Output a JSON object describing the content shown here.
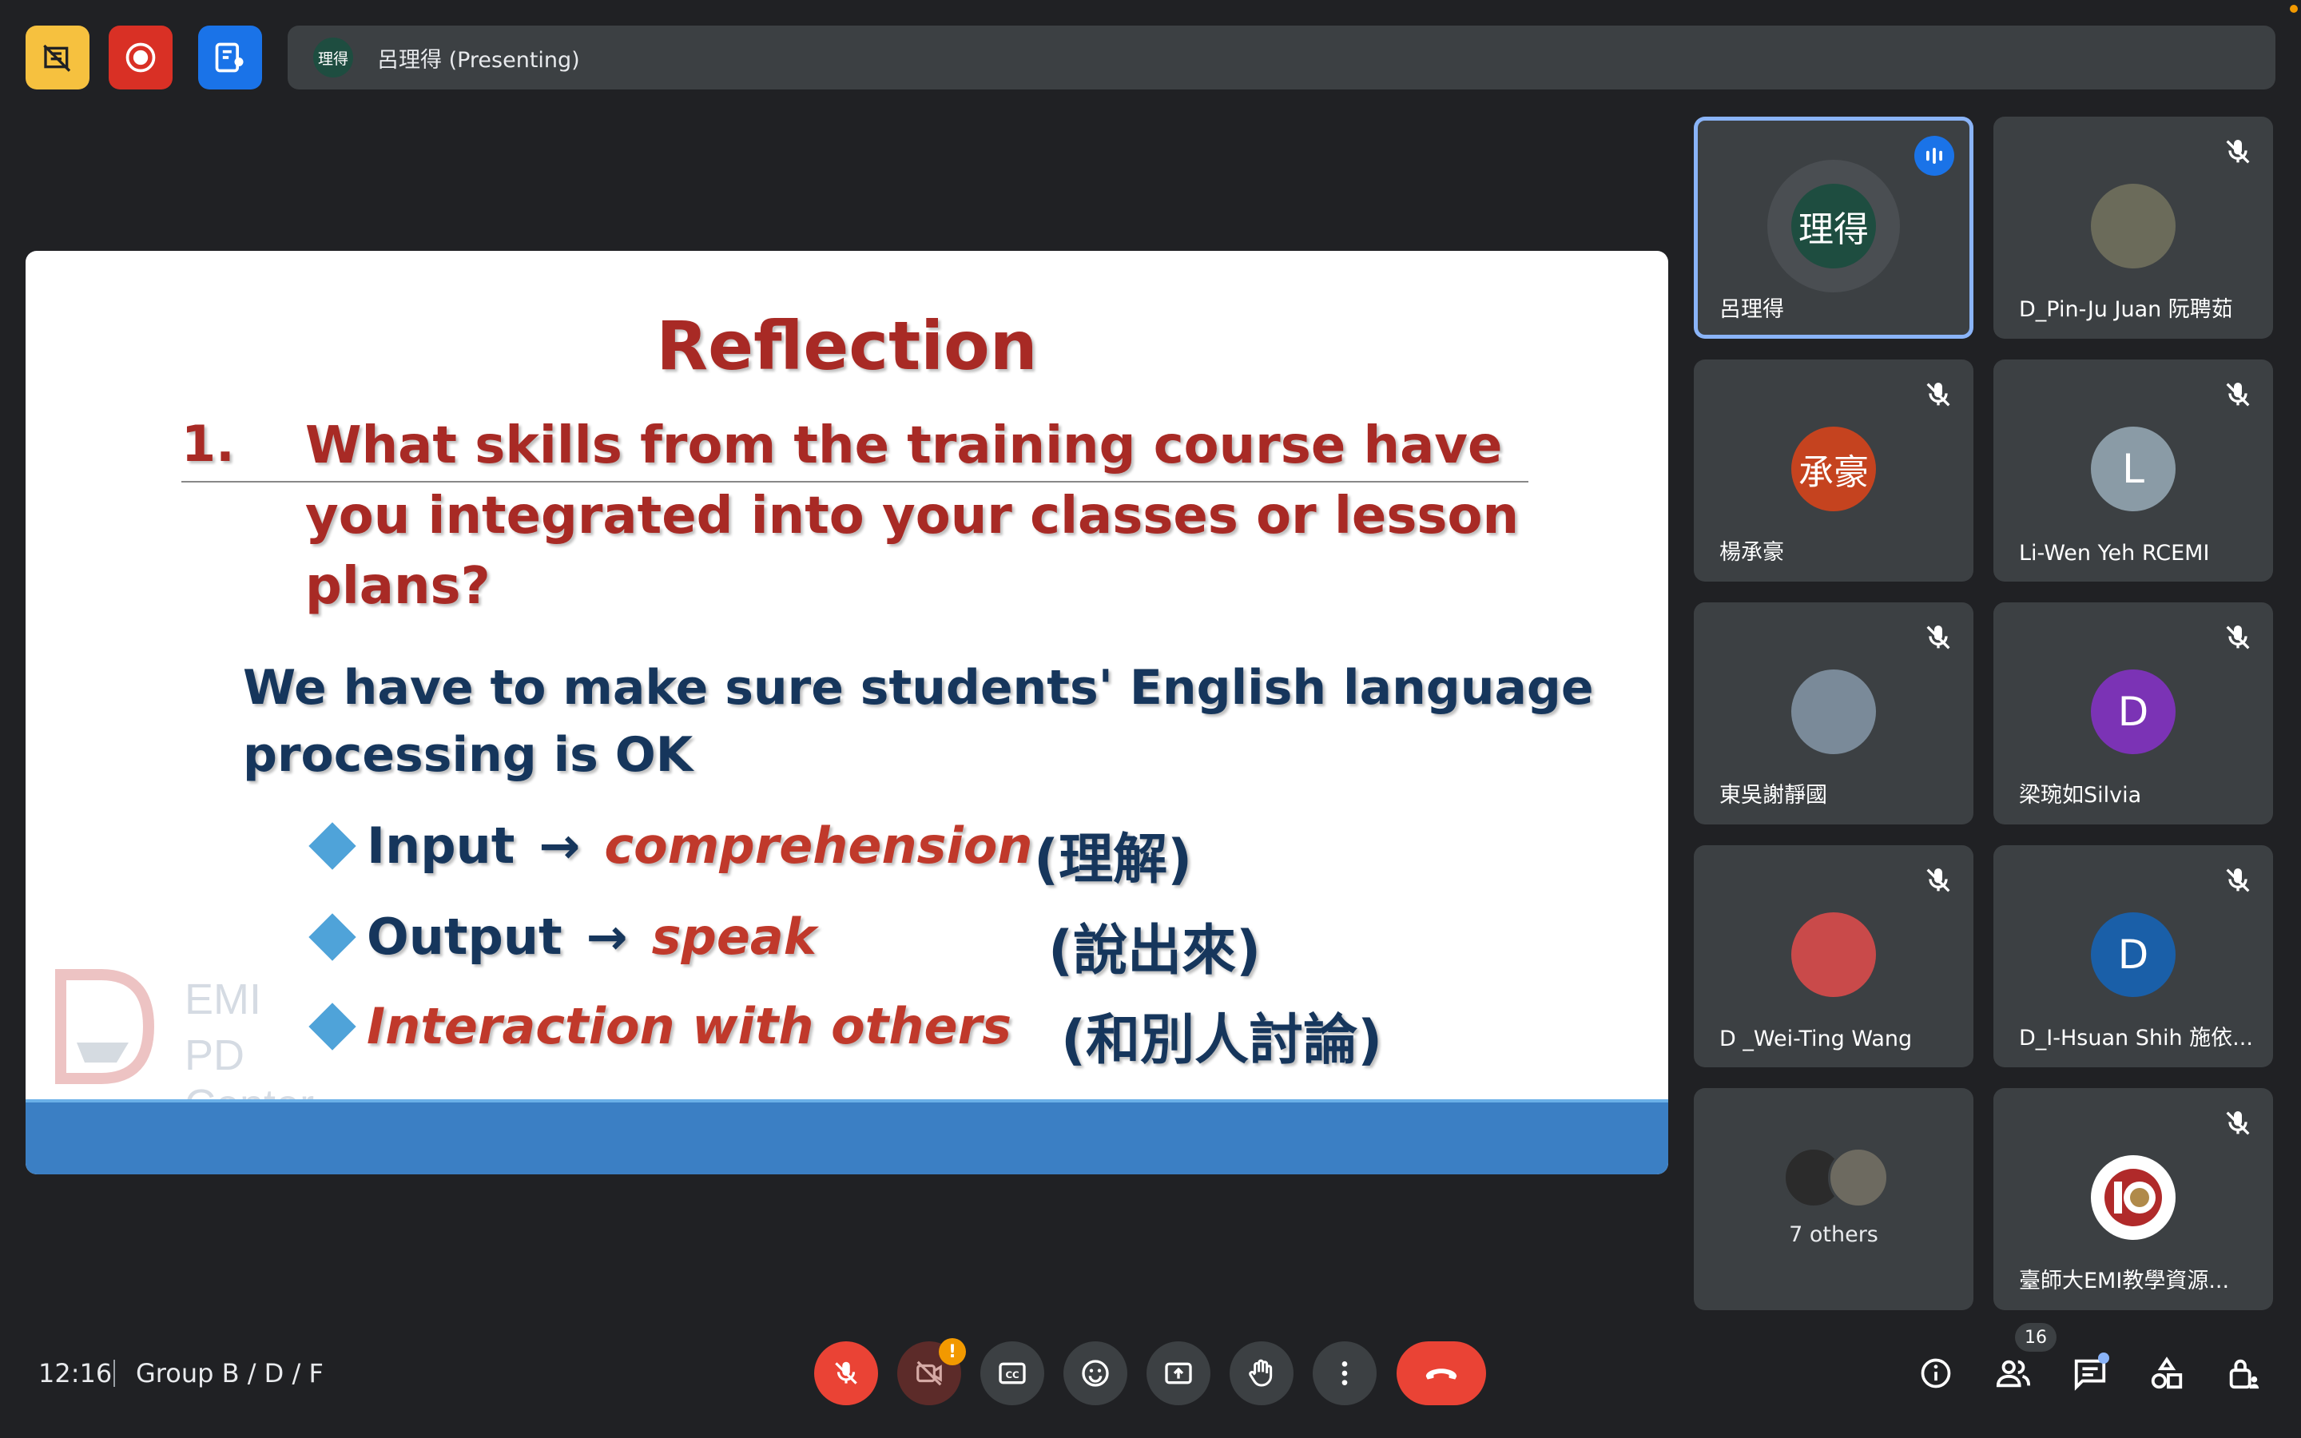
{
  "topbar": {
    "presenter_avatar_text": "理得",
    "presenting_label": "呂理得 (Presenting)",
    "buttons": [
      "no-video-layout-icon",
      "record-icon",
      "present-screen-icon"
    ],
    "colors": {
      "yellow": "#f6c13f",
      "red": "#d93025",
      "blue": "#1a73e8"
    }
  },
  "slide": {
    "title": "Reflection",
    "question_number": "1.",
    "question": "What skills from the training course have you integrated into your classes or lesson plans?",
    "statement": "We have to make sure students' English language processing is OK",
    "bullets": [
      {
        "term": "Input",
        "arrow": "→",
        "result": "comprehension",
        "cjk": "(理解)"
      },
      {
        "term": "Output",
        "arrow": "→",
        "result": "speak",
        "cjk": "(說出來)"
      },
      {
        "term": "",
        "arrow": "",
        "result": "Interaction with others",
        "cjk": "(和別人討論)"
      }
    ],
    "watermark_line1": "EMI",
    "watermark_line2": "PD Center"
  },
  "participants": [
    {
      "name": "呂理得",
      "avatar_text": "理得",
      "avatar_color": "#1e4d40",
      "speaking": true
    },
    {
      "name": "D_Pin-Ju Juan 阮聘茹",
      "avatar_text": "",
      "avatar_color": "#6b6b5a",
      "muted": true
    },
    {
      "name": "楊承豪",
      "avatar_text": "承豪",
      "avatar_color": "#c5431f",
      "muted": true
    },
    {
      "name": "Li-Wen Yeh RCEMI",
      "avatar_text": "L",
      "avatar_color": "#8a9ba6",
      "muted": true
    },
    {
      "name": "東吳謝靜國",
      "avatar_text": "",
      "avatar_color": "#7a8a99",
      "muted": true
    },
    {
      "name": "梁琬如Silvia",
      "avatar_text": "D",
      "avatar_color": "#7b33b5",
      "muted": true
    },
    {
      "name": "D _Wei-Ting Wang",
      "avatar_text": "",
      "avatar_color": "#c94a4a",
      "muted": true
    },
    {
      "name": "D_I-Hsuan Shih 施依...",
      "avatar_text": "D",
      "avatar_color": "#1a5fa8",
      "muted": true
    },
    {
      "name": "7 others",
      "avatar_text": "",
      "avatar_color": "#555"
    },
    {
      "name": "臺師大EMI教學資源...",
      "avatar_text": "",
      "avatar_color": "#ffffff",
      "muted": true
    }
  ],
  "bottombar": {
    "time": "12:16",
    "meeting_name": "Group B / D / F",
    "participant_count": "16",
    "camera_warning": "!"
  }
}
